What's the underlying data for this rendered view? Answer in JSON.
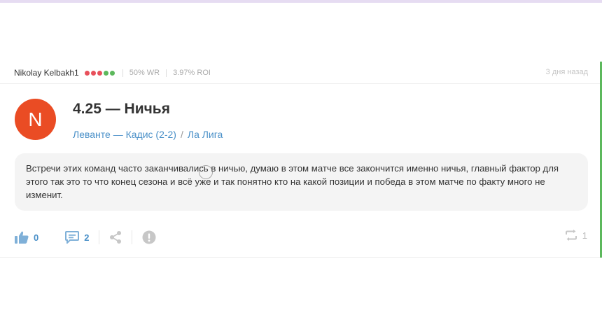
{
  "post": {
    "author": "Nikolay Kelbakh1",
    "form_dots": [
      "#e8505b",
      "#e8505b",
      "#e8505b",
      "#5cb85c",
      "#5cb85c"
    ],
    "win_rate": "50% WR",
    "roi": "3.97% ROI",
    "time_ago": "3 дня назад",
    "avatar_letter": "N",
    "avatar_color": "#ea4c24",
    "bet_title": "4.25 — Ничья",
    "match": "Леванте — Кадис (2-2)",
    "league": "Ла Лига",
    "comment": "Встречи этих команд часто заканчивались в ничью, думаю в этом матче все закончится именно ничья, главный фактор для этого так это то что конец сезона и всё уже и так понятно кто на какой позиции и победа в этом матче по факту много не изменит."
  },
  "actions": {
    "likes": "0",
    "comments": "2",
    "reposts": "1"
  },
  "icons": {
    "like": "thumbs-up-icon",
    "comment": "comment-icon",
    "share": "share-icon",
    "report": "exclamation-icon",
    "repost": "repost-icon"
  },
  "colors": {
    "accent": "#4a90c8",
    "win": "#5cb85c",
    "loss": "#e8505b"
  }
}
